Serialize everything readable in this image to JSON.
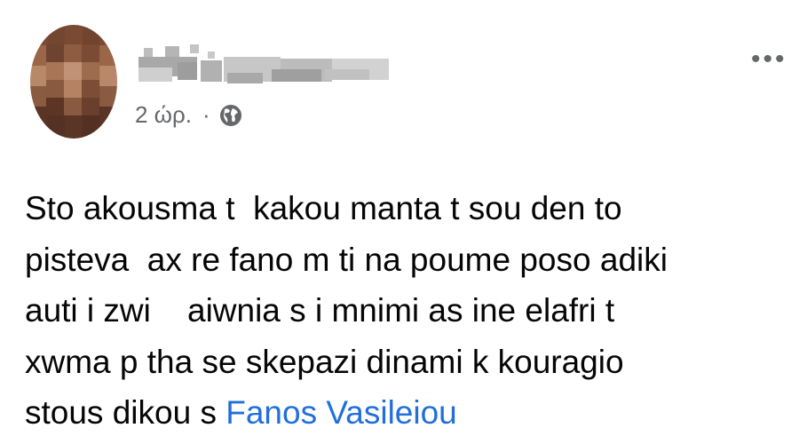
{
  "post": {
    "time_label": "2 ώρ.",
    "separator": "·",
    "visibility_icon": "globe-icon",
    "more_label": "•••",
    "lines": [
      "Sto akousma t  kakou manta t sou den to",
      "pisteva  ax re fano m ti na poume poso adiki",
      "auti i zwi    aiwnia s i mnimi as ine elafri t",
      "xwma p tha se skepazi dinami k kouragio",
      "stous dikou s "
    ],
    "mention": "Fanos Vasileiou"
  },
  "colors": {
    "text": "#050505",
    "meta": "#65676b",
    "link": "#216fdb"
  }
}
